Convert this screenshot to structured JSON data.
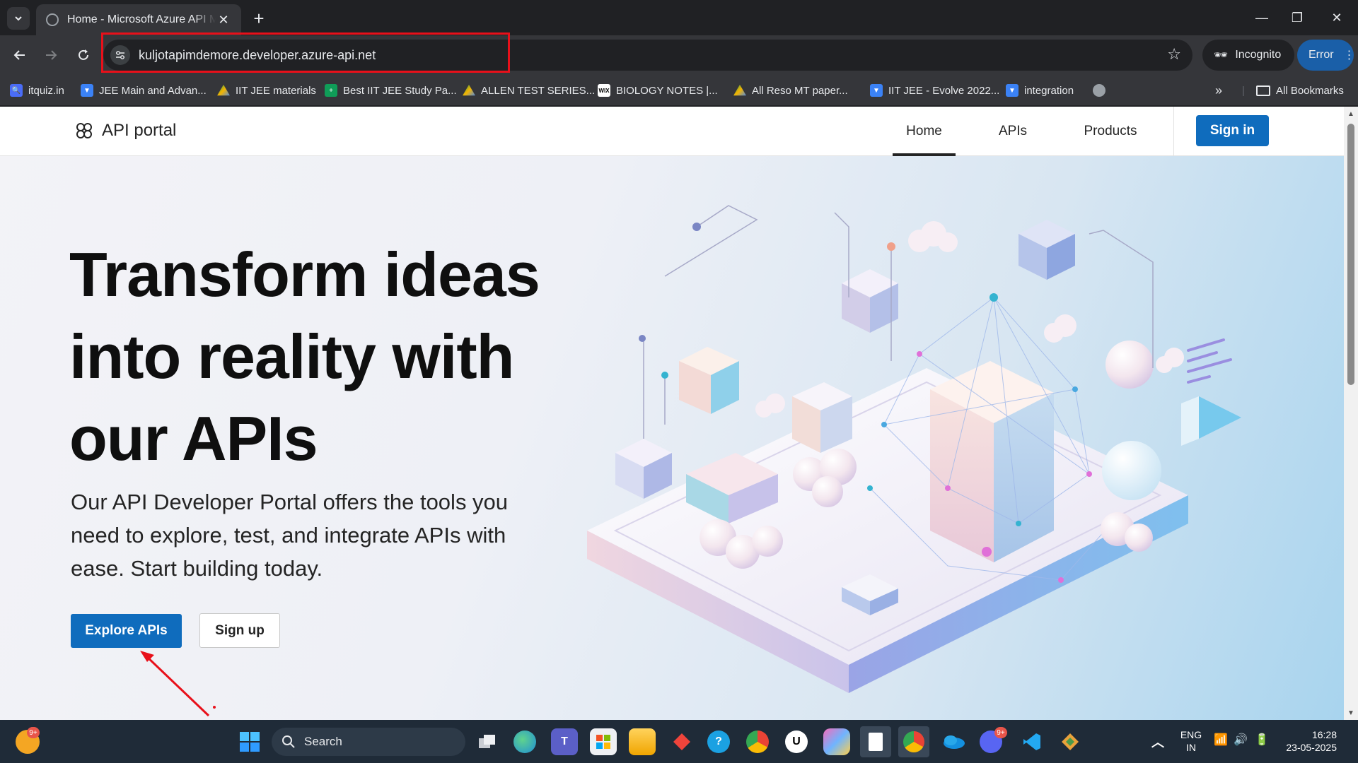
{
  "browser": {
    "tab_title": "Home - Microsoft Azure API Management",
    "url": "kuljotapimdemore.developer.azure-api.net",
    "incognito_label": "Incognito",
    "error_label": "Error",
    "bookmarks": [
      {
        "label": "itquiz.in",
        "icon": "search-icon",
        "color": "#4a6cf7"
      },
      {
        "label": "JEE Main and Advan...",
        "icon": "shield-icon",
        "color": "#3b82f6"
      },
      {
        "label": "IIT JEE materials",
        "icon": "drive-icon",
        "color": "#f4b400"
      },
      {
        "label": "Best IIT JEE Study Pa...",
        "icon": "sheets-icon",
        "color": "#0f9d58"
      },
      {
        "label": "ALLEN TEST SERIES...",
        "icon": "drive-icon",
        "color": "#f4b400"
      },
      {
        "label": "BIOLOGY NOTES |...",
        "icon": "wix-icon",
        "color": "#ffffff"
      },
      {
        "label": "All Reso MT paper...",
        "icon": "drive-icon",
        "color": "#f4b400"
      },
      {
        "label": "IIT JEE - Evolve 2022...",
        "icon": "shield-icon",
        "color": "#3b82f6"
      },
      {
        "label": "integration",
        "icon": "shield-icon",
        "color": "#3b82f6"
      }
    ],
    "all_bookmarks_label": "All Bookmarks"
  },
  "site": {
    "logo_text": "API portal",
    "nav": [
      {
        "label": "Home",
        "active": true
      },
      {
        "label": "APIs",
        "active": false
      },
      {
        "label": "Products",
        "active": false
      }
    ],
    "signin_label": "Sign in",
    "hero_title": "Transform ideas into reality with our APIs",
    "hero_subtitle": "Our API Developer Portal offers the tools you need to explore, test, and integrate APIs with ease. Start building today.",
    "explore_label": "Explore APIs",
    "signup_label": "Sign up",
    "accent_color": "#0f6cbd"
  },
  "taskbar": {
    "search_label": "Search",
    "language": "ENG",
    "region": "IN",
    "time": "16:28",
    "date": "23-05-2025",
    "weather_badge": "9+",
    "discord_badge": "9+",
    "apps": [
      "windows-start-icon",
      "task-view-icon",
      "edge-icon",
      "teams-icon",
      "store-icon",
      "file-explorer-icon",
      "anydesk-icon",
      "help-icon",
      "chrome-icon",
      "udemy-icon",
      "copilot-icon",
      "sheets-app-icon",
      "chrome-active-icon",
      "onedrive-icon",
      "discord-icon",
      "vscode-icon",
      "git-icon"
    ]
  }
}
